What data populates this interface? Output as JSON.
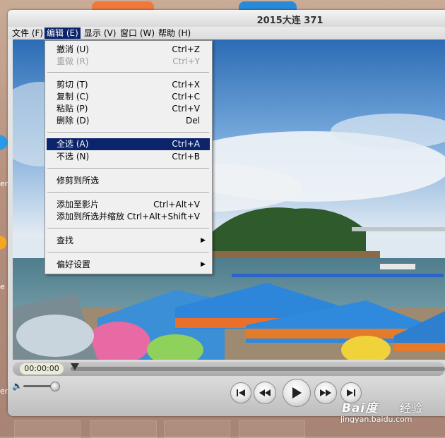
{
  "window": {
    "title": "2015大连 371"
  },
  "menubar": [
    {
      "label": "文件",
      "key": "(F)"
    },
    {
      "label": "编辑",
      "key": "(E)"
    },
    {
      "label": "显示",
      "key": "(V)"
    },
    {
      "label": "窗口",
      "key": "(W)"
    },
    {
      "label": "帮助",
      "key": "(H)"
    }
  ],
  "edit_menu": {
    "items": [
      {
        "label": "撤消 (U)",
        "shortcut": "Ctrl+Z"
      },
      {
        "label": "重做 (R)",
        "shortcut": "Ctrl+Y"
      },
      {
        "label": "剪切 (T)",
        "shortcut": "Ctrl+X"
      },
      {
        "label": "复制 (C)",
        "shortcut": "Ctrl+C"
      },
      {
        "label": "粘贴 (P)",
        "shortcut": "Ctrl+V"
      },
      {
        "label": "删除 (D)",
        "shortcut": "Del"
      },
      {
        "label": "全选 (A)",
        "shortcut": "Ctrl+A"
      },
      {
        "label": "不选 (N)",
        "shortcut": "Ctrl+B"
      },
      {
        "label": "修剪到所选",
        "shortcut": ""
      },
      {
        "label": "添加至影片",
        "shortcut": "Ctrl+Alt+V"
      },
      {
        "label": "添加到所选并缩放",
        "shortcut": "Ctrl+Alt+Shift+V"
      },
      {
        "label": "查找",
        "shortcut": ""
      },
      {
        "label": "偏好设置",
        "shortcut": ""
      }
    ]
  },
  "player": {
    "time": "00:00:00"
  },
  "desktop": {
    "label1": "er",
    "label2": "e",
    "label3": "er"
  },
  "watermark": {
    "logo": "Bai度",
    "text": "经验",
    "url": "jingyan.baidu.com"
  }
}
